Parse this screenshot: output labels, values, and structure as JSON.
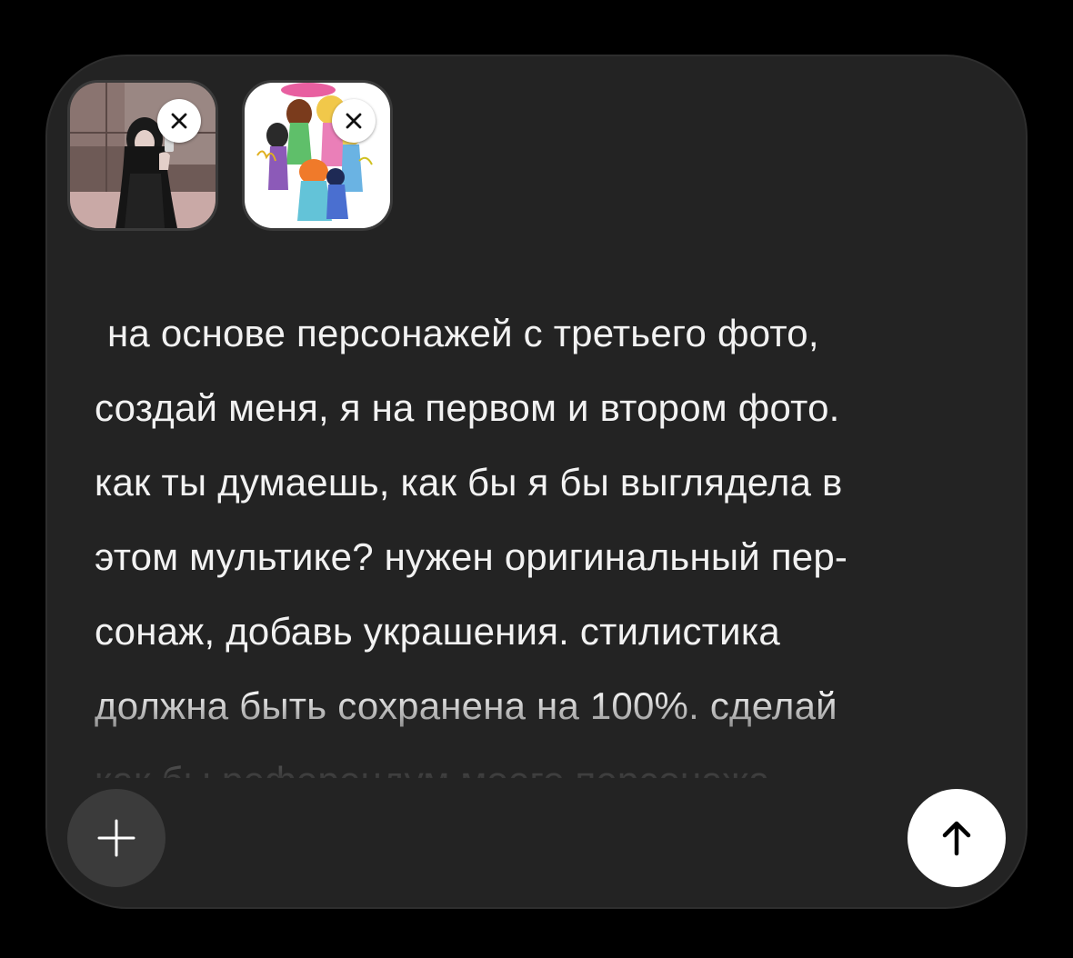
{
  "composer": {
    "attachments": [
      {
        "kind": "photo",
        "subject": "mirror selfie",
        "remove_icon": "close-icon"
      },
      {
        "kind": "photo",
        "subject": "cartoon characters",
        "remove_icon": "close-icon"
      }
    ],
    "message_lines": [
      "на основе персонажей с третьего фото,",
      "создай меня, я на первом и втором фото.",
      "как ты думаешь, как бы я бы выглядела в",
      "этом мультике? нужен оригинальный пер-",
      "сонаж, добавь украшения. стилистика",
      "должна быть сохранена на 100%. сделай",
      "как бы референдум моего персонажа"
    ],
    "add_icon": "plus-icon",
    "send_icon": "arrow-up-icon"
  },
  "colors": {
    "background": "#000000",
    "composer_bg": "#232323",
    "text": "#f2f2f2",
    "add_button_bg": "#3b3b3b",
    "send_button_bg": "#ffffff"
  }
}
